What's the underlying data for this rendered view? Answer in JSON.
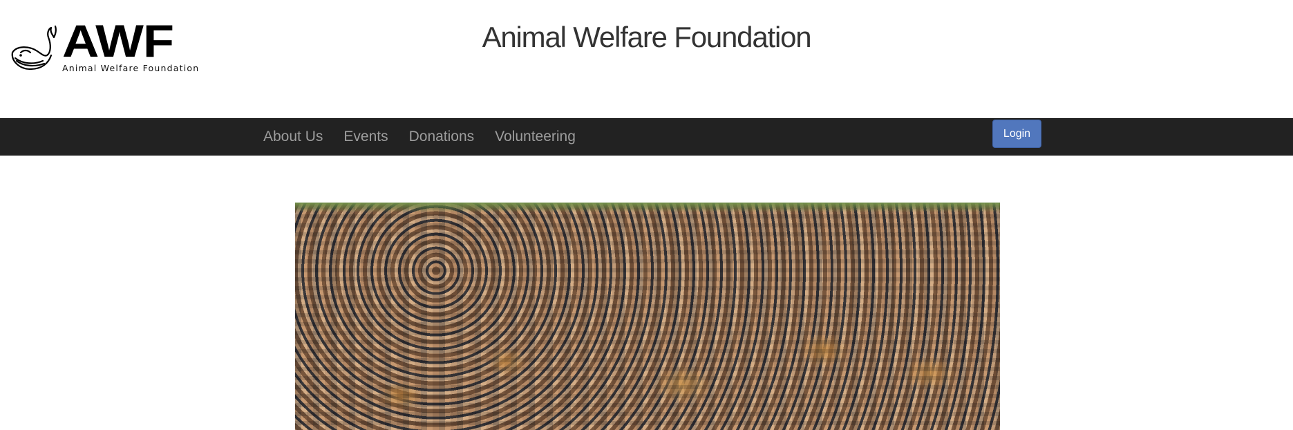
{
  "header": {
    "logo_mark": "AWF",
    "logo_subtitle": "Animal Welfare Foundation",
    "site_title": "Animal Welfare Foundation"
  },
  "nav": {
    "links": [
      "About Us",
      "Events",
      "Donations",
      "Volunteering"
    ],
    "login_label": "Login"
  },
  "colors": {
    "navbar_bg": "#222222",
    "nav_link": "#9d9d9d",
    "login_button": "#5177bd",
    "title_text": "#333333"
  },
  "icons": {
    "logo": "whale-icon"
  }
}
